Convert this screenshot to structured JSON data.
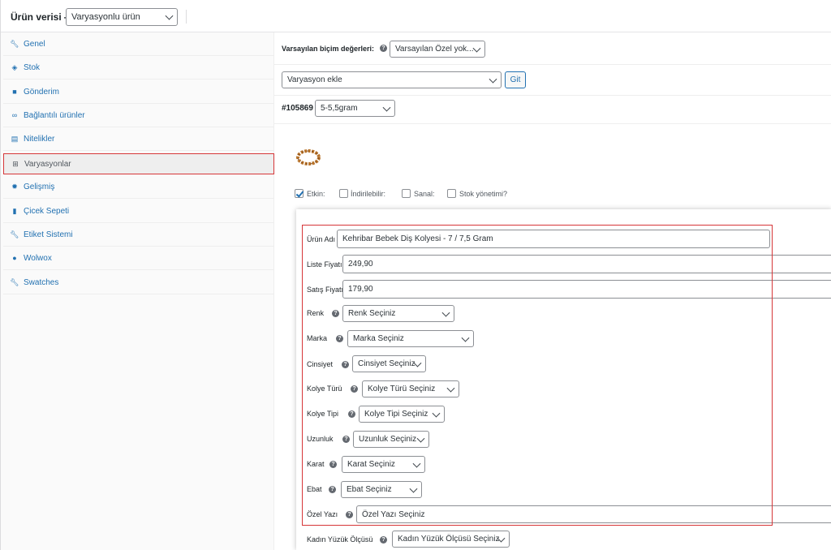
{
  "header": {
    "title": "Ürün verisi —",
    "product_type": "Varyasyonlu ürün"
  },
  "sidebar": {
    "items": [
      {
        "label": "Genel",
        "icon": "wrench-icon"
      },
      {
        "label": "Stok",
        "icon": "tag-icon"
      },
      {
        "label": "Gönderim",
        "icon": "truck-icon"
      },
      {
        "label": "Bağlantılı ürünler",
        "icon": "link-icon"
      },
      {
        "label": "Nitelikler",
        "icon": "list-icon"
      },
      {
        "label": "Varyasyonlar",
        "icon": "grid-icon",
        "active": true
      },
      {
        "label": "Gelişmiş",
        "icon": "gear-icon"
      },
      {
        "label": "Çicek Sepeti",
        "icon": "bar-chart-icon"
      },
      {
        "label": "Etiket Sistemi",
        "icon": "wrench-icon"
      },
      {
        "label": "Wolwox",
        "icon": "circle-icon"
      },
      {
        "label": "Swatches",
        "icon": "wrench-icon"
      }
    ]
  },
  "defaults": {
    "label": "Varsayılan biçim değerleri:",
    "value": "Varsayılan Özel yok..."
  },
  "add_variation": {
    "select_value": "Varyasyon ekle",
    "go_label": "Git"
  },
  "variation": {
    "id": "#105869",
    "attribute_value": "5-5,5gram",
    "checks": [
      {
        "label": "Etkin:",
        "checked": true
      },
      {
        "label": "İndirilebilir:",
        "checked": false
      },
      {
        "label": "Sanal:",
        "checked": false
      },
      {
        "label": "Stok yönetimi?",
        "checked": false
      }
    ]
  },
  "fields": {
    "product_name_label": "Ürün Adı",
    "product_name_value": "Kehribar Bebek Diş Kolyesi - 7 / 7,5 Gram",
    "list_price_label": "Liste Fiyatı",
    "list_price_value": "249,90",
    "sale_price_label": "Satış Fiyatı",
    "sale_price_value": "179,90"
  },
  "attributes": [
    {
      "label": "Renk",
      "value": "Renk Seçiniz"
    },
    {
      "label": "Marka",
      "value": "Marka Seçiniz"
    },
    {
      "label": "Cinsiyet",
      "value": "Cinsiyet Seçiniz"
    },
    {
      "label": "Kolye Türü",
      "value": "Kolye Türü Seçiniz"
    },
    {
      "label": "Kolye Tipi",
      "value": "Kolye Tipi Seçiniz"
    },
    {
      "label": "Uzunluk",
      "value": "Uzunluk Seçiniz"
    },
    {
      "label": "Karat",
      "value": "Karat Seçiniz"
    },
    {
      "label": "Ebat",
      "value": "Ebat Seçiniz"
    },
    {
      "label": "Özel Yazı",
      "value": "Özel Yazı Seçiniz"
    },
    {
      "label": "Kadın Yüzük Ölçüsü",
      "value": "Kadın Yüzük Ölçüsü Seçiniz"
    }
  ],
  "colors": {
    "link": "#2271b1",
    "highlight": "#d63638"
  }
}
